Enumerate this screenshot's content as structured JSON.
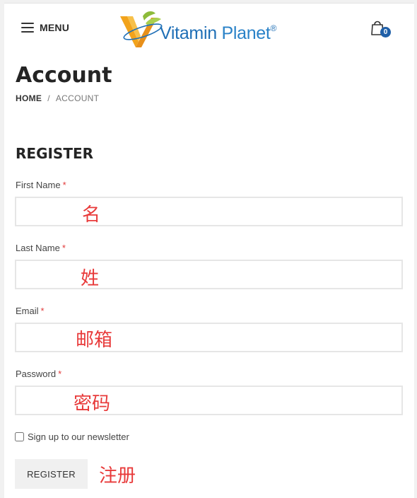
{
  "header": {
    "menu_label": "MENU",
    "logo_text_1": "Vitamin",
    "logo_text_2": "Planet",
    "logo_reg": "®",
    "cart_count": "0"
  },
  "page": {
    "title": "Account",
    "breadcrumb": {
      "home": "HOME",
      "separator": "/",
      "current": "ACCOUNT"
    }
  },
  "register": {
    "section_title": "REGISTER",
    "required_mark": "*",
    "fields": [
      {
        "label": "First Name",
        "value": "",
        "annotation": "名"
      },
      {
        "label": "Last Name",
        "value": "",
        "annotation": "姓"
      },
      {
        "label": "Email",
        "value": "",
        "annotation": "邮箱"
      },
      {
        "label": "Password",
        "value": "",
        "annotation": "密码"
      }
    ],
    "newsletter_label": "Sign up to our newsletter",
    "newsletter_checked": false,
    "button_label": "REGISTER",
    "button_annotation": "注册"
  },
  "colors": {
    "brand_blue": "#1f6fb6",
    "brand_orange": "#f2a31b",
    "brand_green": "#8dbb3a",
    "required_red": "#e23b3b",
    "annotation_red": "#e83a3a"
  }
}
